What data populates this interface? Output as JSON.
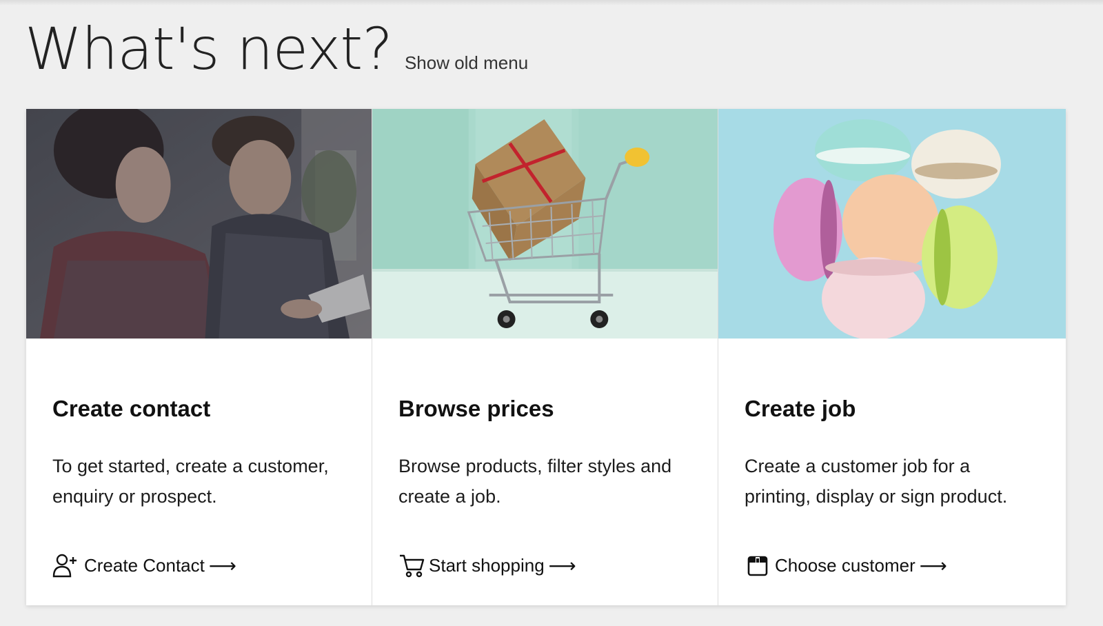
{
  "header": {
    "title": "What's next?",
    "show_old_menu": "Show old menu"
  },
  "cards": [
    {
      "title": "Create contact",
      "description": "To get started, create a customer, enquiry or prospect.",
      "link_label": "Create Contact",
      "link_icon": "add-user-icon",
      "image": "photo of two people reviewing a document"
    },
    {
      "title": "Browse prices",
      "description": "Browse products, filter styles and create a job.",
      "link_label": "Start shopping",
      "link_icon": "shopping-cart-icon",
      "image": "photo of a gift box in a miniature shopping cart"
    },
    {
      "title": "Create job",
      "description": "Create a customer job for a printing, display or sign product.",
      "link_label": "Choose customer",
      "link_icon": "job-box-icon",
      "image": "photo of pastel macarons"
    }
  ],
  "colors": {
    "background": "#efefef",
    "card": "#ffffff",
    "text": "#111111"
  }
}
